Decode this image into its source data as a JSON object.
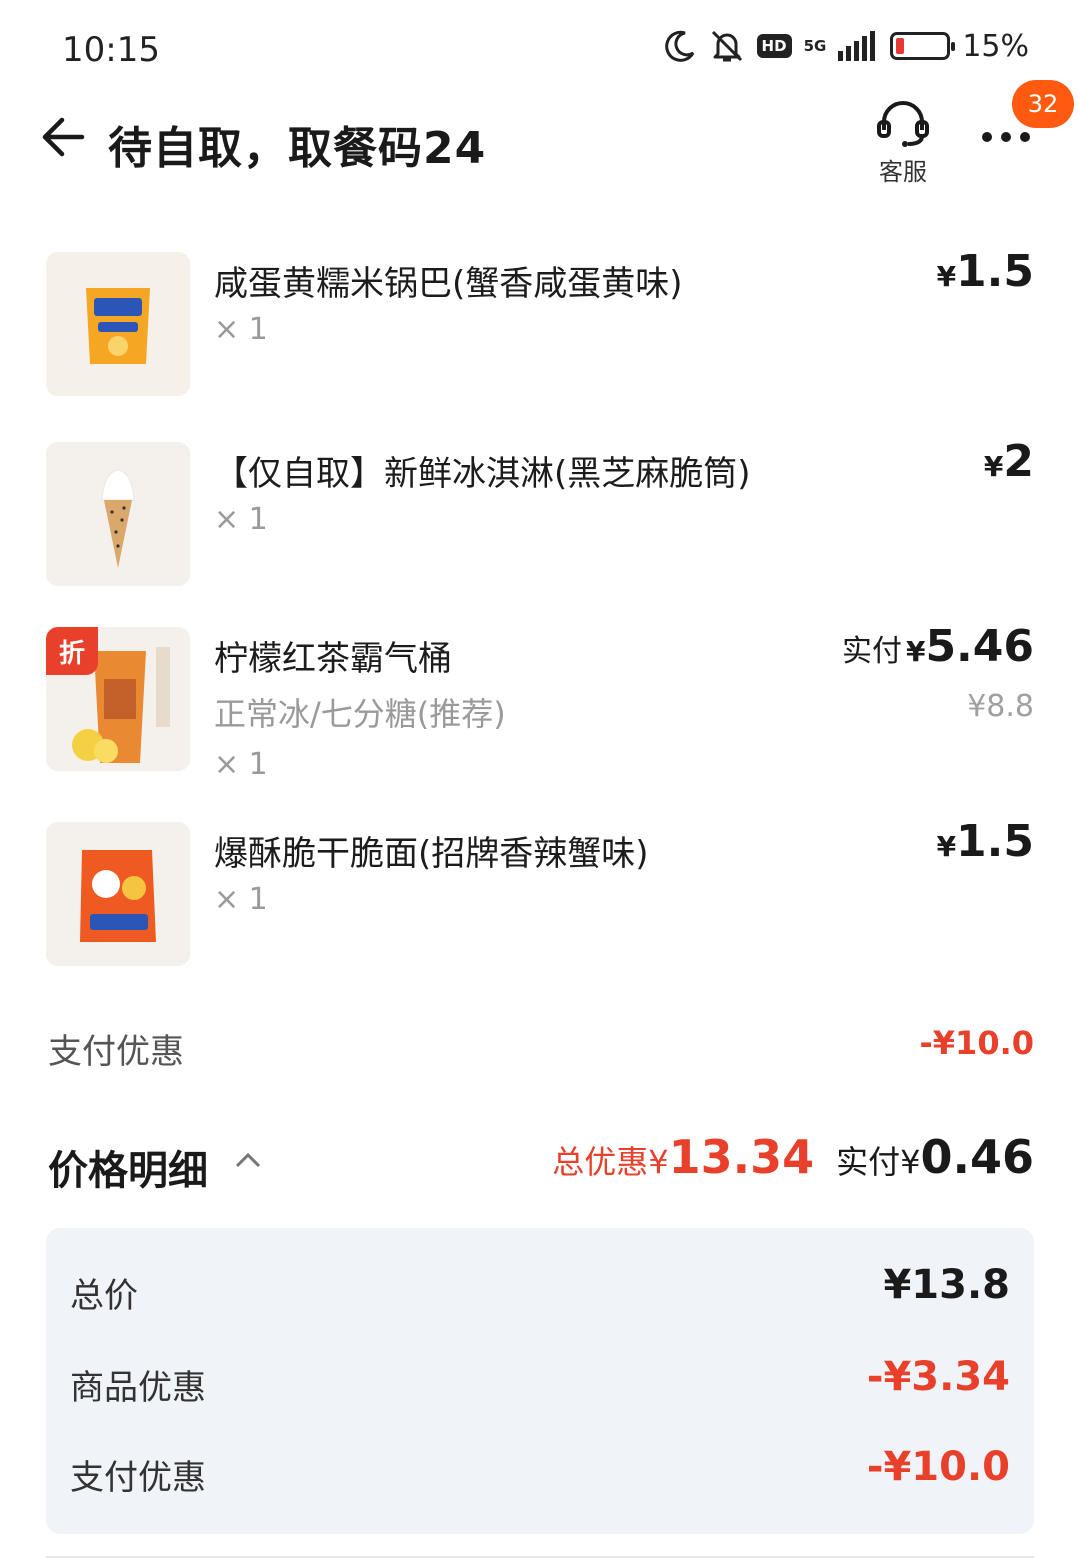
{
  "status_bar": {
    "time": "10:15",
    "network": "5G",
    "hd": "HD",
    "battery_percent": "15%",
    "battery_level": 0.15,
    "icons": [
      "moon-icon",
      "bell-off-icon",
      "hd-icon",
      "5g-icon",
      "signal-icon",
      "battery-icon"
    ]
  },
  "header": {
    "title": "待自取，取餐码24",
    "service_label": "客服",
    "notification_count": "32"
  },
  "items": [
    {
      "name": "咸蛋黄糯米锅巴(蟹香咸蛋黄味)",
      "qty": "× 1",
      "price_currency": "¥",
      "price": "1.5"
    },
    {
      "name": "【仅自取】新鲜冰淇淋(黑芝麻脆筒)",
      "qty": "× 1",
      "price_currency": "¥",
      "price": "2"
    },
    {
      "name": "柠檬红茶霸气桶",
      "spec": "正常冰/七分糖(推荐)",
      "qty": "× 1",
      "price_label": "实付",
      "price_currency": "¥",
      "price": "5.46",
      "original_price": "¥8.8",
      "discount_tag": "折"
    },
    {
      "name": "爆酥脆干脆面(招牌香辣蟹味)",
      "qty": "× 1",
      "price_currency": "¥",
      "price": "1.5"
    }
  ],
  "payment_discount": {
    "label": "支付优惠",
    "value": "-¥10.0"
  },
  "summary": {
    "title": "价格明细",
    "total_discount_label": "总优惠",
    "total_discount_currency": "¥",
    "total_discount_value": "13.34",
    "paid_label": "实付",
    "paid_currency": "¥",
    "paid_value": "0.46"
  },
  "breakdown": [
    {
      "label": "总价",
      "value": "¥13.8"
    },
    {
      "label": "商品优惠",
      "value": "-¥3.34"
    },
    {
      "label": "支付优惠",
      "value": "-¥10.0"
    }
  ],
  "colors": {
    "accent_red": "#e8402a",
    "badge_orange": "#ff5a0f",
    "panel_bg": "#f0f3f8"
  }
}
